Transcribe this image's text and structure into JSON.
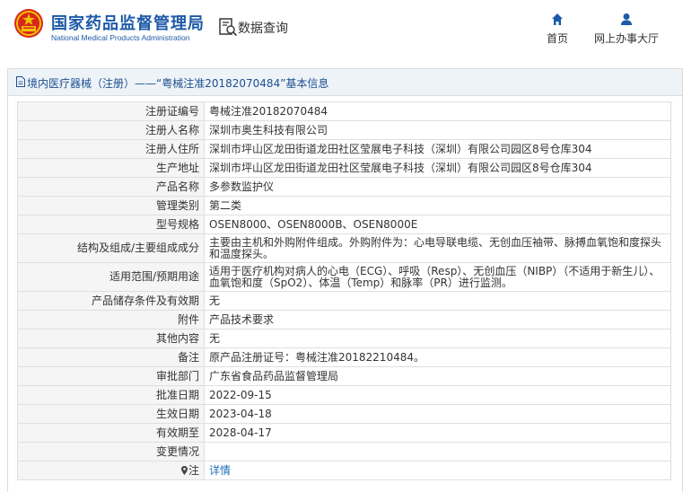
{
  "header": {
    "org_name_cn": "国家药品监督管理局",
    "org_name_en": "National Medical Products Administration",
    "query_label": "数据查询",
    "nav": [
      {
        "label": "首页",
        "icon": "home-icon"
      },
      {
        "label": "网上办事大厅",
        "icon": "person-icon"
      }
    ]
  },
  "panel": {
    "title": "境内医疗器械（注册）——“粤械注准20182070484”基本信息"
  },
  "rows": [
    {
      "label": "注册证编号",
      "value": "粤械注准20182070484"
    },
    {
      "label": "注册人名称",
      "value": "深圳市奥生科技有限公司"
    },
    {
      "label": "注册人住所",
      "value": "深圳市坪山区龙田街道龙田社区莹展电子科技（深圳）有限公司园区8号仓库304"
    },
    {
      "label": "生产地址",
      "value": "深圳市坪山区龙田街道龙田社区莹展电子科技（深圳）有限公司园区8号仓库304"
    },
    {
      "label": "产品名称",
      "value": "多参数监护仪"
    },
    {
      "label": "管理类别",
      "value": "第二类"
    },
    {
      "label": "型号规格",
      "value": "OSEN8000、OSEN8000B、OSEN8000E"
    },
    {
      "label": "结构及组成/主要组成成分",
      "value": "主要由主机和外购附件组成。外购附件为：心电导联电缆、无创血压袖带、脉搏血氧饱和度探头和温度探头。"
    },
    {
      "label": "适用范围/预期用途",
      "value": "适用于医疗机构对病人的心电（ECG）、呼吸（Resp）、无创血压（NIBP）（不适用于新生儿）、血氧饱和度（SpO2）、体温（Temp）和脉率（PR）进行监测。"
    },
    {
      "label": "产品储存条件及有效期",
      "value": "无"
    },
    {
      "label": "附件",
      "value": "产品技术要求"
    },
    {
      "label": "其他内容",
      "value": "无"
    },
    {
      "label": "备注",
      "value": "原产品注册证号：粤械注准20182210484。"
    },
    {
      "label": "审批部门",
      "value": "广东省食品药品监督管理局"
    },
    {
      "label": "批准日期",
      "value": "2022-09-15"
    },
    {
      "label": "生效日期",
      "value": "2023-04-18"
    },
    {
      "label": "有效期至",
      "value": "2028-04-17"
    },
    {
      "label": "变更情况",
      "value": ""
    },
    {
      "label": "注",
      "value": "详情"
    }
  ]
}
